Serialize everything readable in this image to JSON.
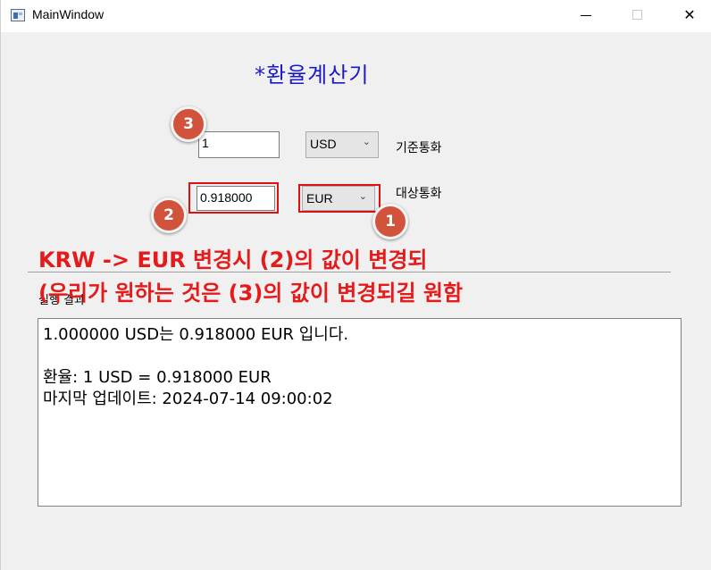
{
  "window": {
    "title": "MainWindow",
    "icons": {
      "app": "app-window-icon",
      "minimize": "minimize-icon",
      "maximize": "maximize-icon",
      "close": "close-icon"
    },
    "close_glyph": "✕"
  },
  "main": {
    "heading": "*환율계산기",
    "base": {
      "amount": "1",
      "currency": "USD",
      "label": "기준통화"
    },
    "target": {
      "amount": "0.918000",
      "currency": "EUR",
      "label": "대상통화"
    },
    "chevron": "⌄",
    "group_label": "실행 결과",
    "results": {
      "line1": "1.000000 USD는 0.918000 EUR 입니다.",
      "line2": "",
      "line3": "환율: 1 USD = 0.918000 EUR",
      "line4": "마지막 업데이트: 2024-07-14 09:00:02"
    }
  },
  "annotations": {
    "badge1": "1",
    "badge2": "2",
    "badge3": "3",
    "line1": "KRW -> EUR 변경시 (2)의 값이 변경되",
    "line2": "(우리가 원하는 것은 (3)의 값이 변경되길 원함",
    "colors": {
      "annotation_red": "#e51b1b",
      "badge_fill": "#d1533c",
      "heading_blue": "#1a1acc"
    }
  }
}
